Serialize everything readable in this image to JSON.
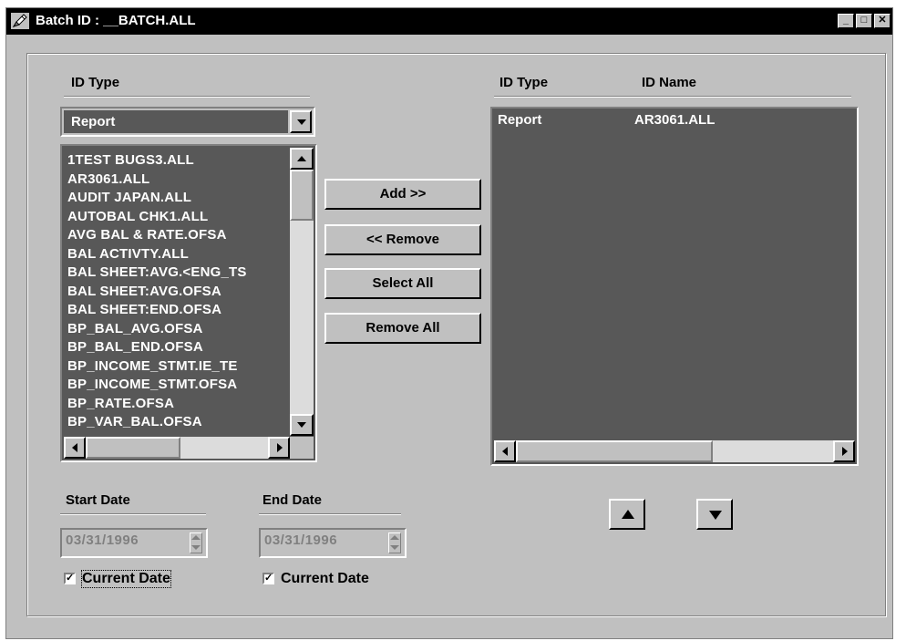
{
  "window": {
    "title": "Batch ID : __BATCH.ALL",
    "minimize_glyph": "_",
    "maximize_glyph": "□",
    "close_glyph": "✕"
  },
  "left": {
    "id_type_label": "ID Type",
    "id_type_value": "Report",
    "items": [
      "1TEST BUGS3.ALL",
      "AR3061.ALL",
      "AUDIT JAPAN.ALL",
      "AUTOBAL CHK1.ALL",
      "AVG BAL & RATE.OFSA",
      "BAL ACTIVTY.ALL",
      "BAL SHEET:AVG.<ENG_TS",
      "BAL SHEET:AVG.OFSA",
      "BAL SHEET:END.OFSA",
      "BP_BAL_AVG.OFSA",
      "BP_BAL_END.OFSA",
      "BP_INCOME_STMT.IE_TE",
      "BP_INCOME_STMT.OFSA",
      "BP_RATE.OFSA",
      "BP_VAR_BAL.OFSA"
    ]
  },
  "buttons": {
    "add": "Add >>",
    "remove": "<< Remove",
    "select_all": "Select All",
    "remove_all": "Remove All"
  },
  "right": {
    "col_type": "ID Type",
    "col_name": "ID Name",
    "rows": [
      {
        "type": "Report",
        "name": "AR3061.ALL"
      }
    ]
  },
  "dates": {
    "start_label": "Start Date",
    "start_value": "03/31/1996",
    "start_current_label": "Current Date",
    "start_current_checked": true,
    "end_label": "End Date",
    "end_value": "03/31/1996",
    "end_current_label": "Current Date",
    "end_current_checked": true
  },
  "icons": {
    "app": "pencil-icon",
    "up": "up-arrow-icon",
    "down": "down-arrow-icon"
  }
}
